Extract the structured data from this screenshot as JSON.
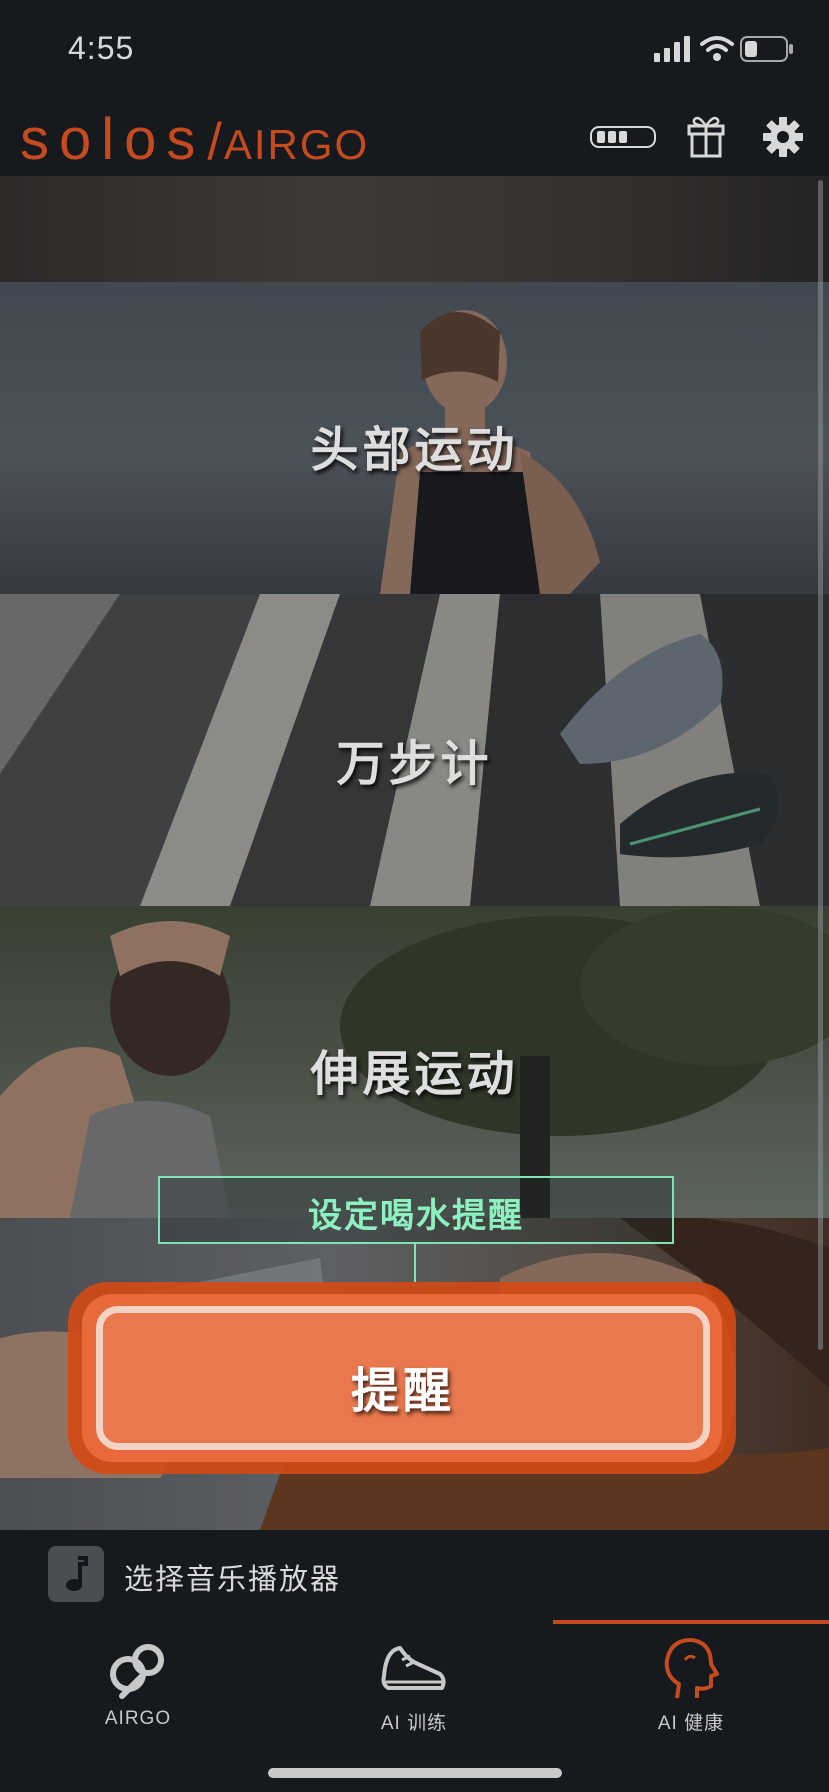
{
  "status_bar": {
    "time": "4:55"
  },
  "header": {
    "logo_main": "solos",
    "logo_sep": "/",
    "logo_sub": "AIRGO",
    "icons": [
      "battery-level-icon",
      "gift-icon",
      "gear-icon"
    ]
  },
  "cards": [
    {
      "label": ""
    },
    {
      "label": "头部运动"
    },
    {
      "label": "万步计"
    },
    {
      "label": "伸展运动"
    },
    {
      "label": "提醒"
    }
  ],
  "tooltip": {
    "text": "设定喝水提醒"
  },
  "highlight": {
    "label": "提醒"
  },
  "music_bar": {
    "label": "选择音乐播放器",
    "icon": "music-note-icon"
  },
  "tabs": [
    {
      "label": "AIRGO",
      "icon": "airgo-logo-icon",
      "active": false
    },
    {
      "label": "AI 训练",
      "icon": "sneaker-icon",
      "active": false
    },
    {
      "label": "AI 健康",
      "icon": "head-profile-icon",
      "active": true
    }
  ],
  "colors": {
    "accent": "#c54a1e",
    "tooltip": "#7fe3b3",
    "background": "#16191d"
  }
}
